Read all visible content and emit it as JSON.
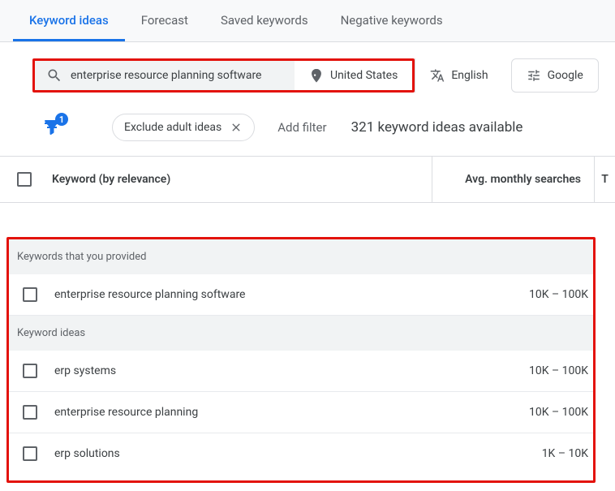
{
  "tabs": {
    "keyword_ideas": "Keyword ideas",
    "forecast": "Forecast",
    "saved_keywords": "Saved keywords",
    "negative_keywords": "Negative keywords"
  },
  "search": {
    "query": "enterprise resource planning software",
    "location": "United States",
    "language": "English",
    "network": "Google"
  },
  "filters": {
    "badge_count": "1",
    "chip_label": "Exclude adult ideas",
    "add_filter": "Add filter",
    "ideas_available": "321 keyword ideas available"
  },
  "headers": {
    "keyword": "Keyword (by relevance)",
    "avg_searches": "Avg. monthly searches",
    "trailing": "T"
  },
  "sections": {
    "provided_label": "Keywords that you provided",
    "ideas_label": "Keyword ideas"
  },
  "provided": [
    {
      "keyword": "enterprise resource planning software",
      "searches": "10K – 100K"
    }
  ],
  "ideas": [
    {
      "keyword": "erp systems",
      "searches": "10K – 100K"
    },
    {
      "keyword": "enterprise resource planning",
      "searches": "10K – 100K"
    },
    {
      "keyword": "erp solutions",
      "searches": "1K – 10K"
    }
  ]
}
